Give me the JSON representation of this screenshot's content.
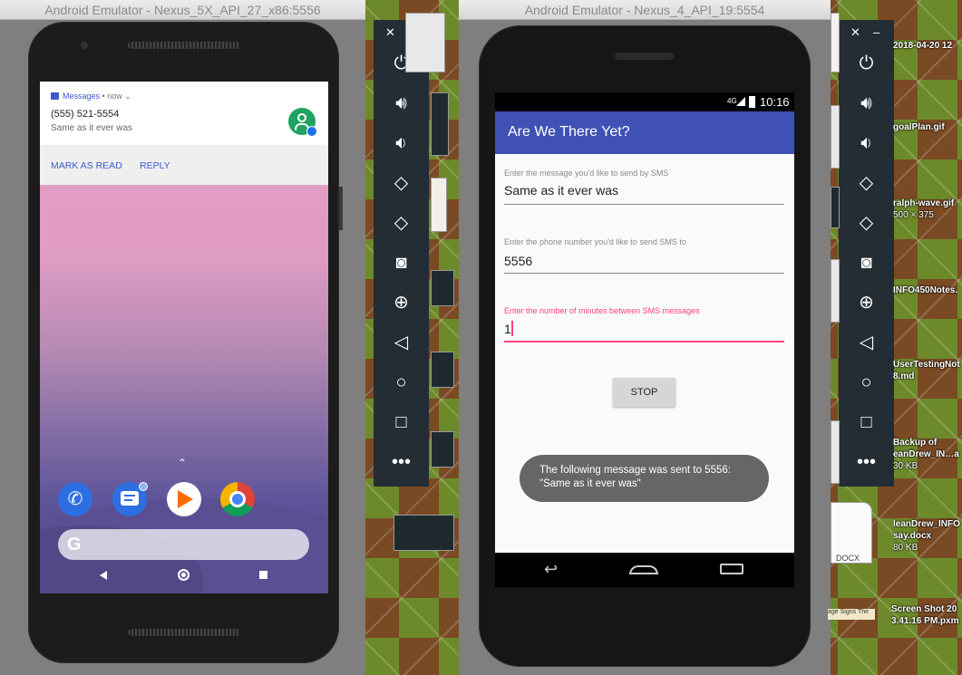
{
  "left_window": {
    "title": "Android Emulator - Nexus_5X_API_27_x86:5556",
    "notification": {
      "app": "Messages",
      "time": "now",
      "sender": "(555) 521-5554",
      "text": "Same as it ever was",
      "action1": "MARK AS READ",
      "action2": "REPLY"
    },
    "dock_icons": [
      "phone-icon",
      "messages-icon",
      "play-music-icon",
      "chrome-icon"
    ],
    "nav": [
      "back-icon",
      "home-icon",
      "recents-icon"
    ]
  },
  "right_window": {
    "title": "Android Emulator - Nexus_4_API_19:5554",
    "status": {
      "network": "4G",
      "time": "10:16"
    },
    "app_title": "Are We There Yet?",
    "field1": {
      "label": "Enter the message you'd like to send by SMS",
      "value": "Same as it ever was"
    },
    "field2": {
      "label": "Enter the phone number you'd like to send SMS to",
      "value": "5556"
    },
    "field3": {
      "label": "Enter the number of minutes between SMS messages",
      "value": "1"
    },
    "button": "STOP",
    "toast": {
      "line1": "The following message was sent to 5556:",
      "line2": "\"Same as it ever was\""
    }
  },
  "emulator_toolbar": [
    "power-icon",
    "volume-up-icon",
    "volume-down-icon",
    "rotate-left-icon",
    "rotate-right-icon",
    "camera-icon",
    "zoom-icon",
    "back-icon",
    "home-icon",
    "overview-icon",
    "more-icon"
  ],
  "desktop": {
    "files": [
      {
        "name": "2018-04-20 12"
      },
      {
        "name": "goalPlan.gif"
      },
      {
        "name": "ralph-wave.gif",
        "size": "500 × 375"
      },
      {
        "name": "INFO450Notes."
      },
      {
        "name": "UserTestingNot",
        "name2": "8.md"
      },
      {
        "name": "Backup of",
        "name2": "eanDrew_IN…a",
        "size": "30 KB"
      },
      {
        "name": "leanDrew_INFO",
        "name2": "say.docx",
        "size": "80 KB"
      },
      {
        "name": "Screen Shot 20",
        "name2": "3.41.16 PM.pxm"
      }
    ],
    "docx_badge": "DOCX",
    "clip_text": "age Signs The"
  },
  "colors": {
    "appbar": "#3f51b5",
    "accent": "#ff4081",
    "toolbar_bg": "#242d33",
    "link_blue": "#1a73e8"
  }
}
